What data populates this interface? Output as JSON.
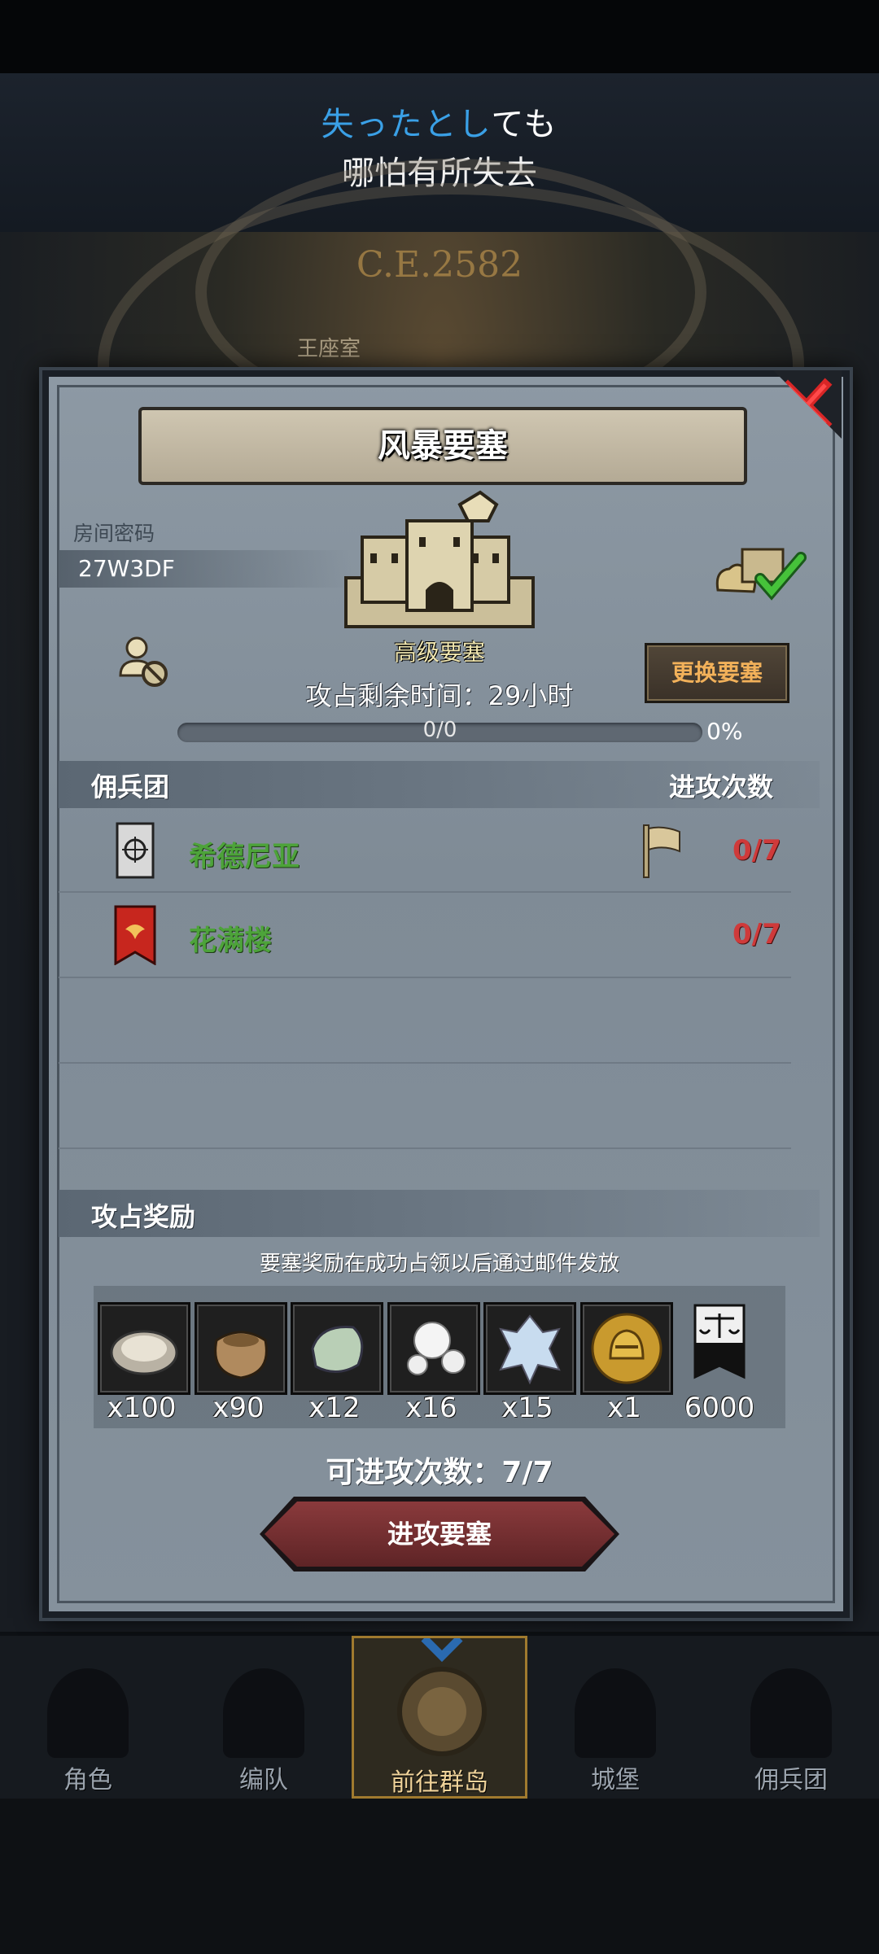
{
  "lyric": {
    "line1_highlight": "失ったとし",
    "line1_rest": "ても",
    "line2": "哪怕有所失去"
  },
  "map": {
    "era": "C.E.2582",
    "throne_label": "王座室"
  },
  "fortress": {
    "title": "风暴要塞",
    "room_label": "房间密码",
    "room_code": "27W3DF",
    "type": "高级要塞",
    "swap_button": "更换要塞",
    "time_left": "攻占剩余时间：29小时",
    "progress_text": "0/0",
    "progress_percent": "0%",
    "progress_value": 0
  },
  "mercenaries": {
    "header": "佣兵团",
    "attacks_header": "进攻次数",
    "rows": [
      {
        "name": "希德尼亚",
        "count": "0/7"
      },
      {
        "name": "花满楼",
        "count": "0/7"
      }
    ]
  },
  "rewards": {
    "header": "攻占奖励",
    "note": "要塞奖励在成功占领以后通过邮件发放",
    "items": [
      {
        "icon": "oyster-icon",
        "qty": "x100"
      },
      {
        "icon": "pouch-icon",
        "qty": "x90"
      },
      {
        "icon": "jade-stone-icon",
        "qty": "x12"
      },
      {
        "icon": "pearl-icon",
        "qty": "x16"
      },
      {
        "icon": "crystal-icon",
        "qty": "x15"
      },
      {
        "icon": "gold-helmet-coin-icon",
        "qty": "x1"
      },
      {
        "icon": "justice-banner-icon",
        "qty": "6000"
      }
    ]
  },
  "remaining_attacks": "可进攻次数：7/7",
  "attack_button": "进攻要塞",
  "nav": {
    "items": [
      {
        "label": "角色"
      },
      {
        "label": "编队"
      },
      {
        "label": "前往群岛"
      },
      {
        "label": "城堡"
      },
      {
        "label": "佣兵团"
      }
    ]
  },
  "colors": {
    "guild_name": "#4da33a",
    "attack_count": "#cf3a3a",
    "highlight_lyric": "#3aa0e6",
    "swap_button_text": "#f2b15a"
  }
}
